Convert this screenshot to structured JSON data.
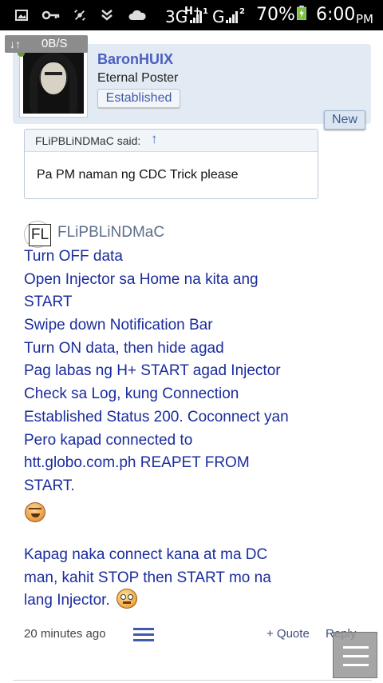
{
  "status_bar": {
    "network_label": "3G",
    "network_sub": "H+",
    "signal_label": "G",
    "battery": "70%",
    "time": "6:00",
    "ampm": "PM",
    "icons": [
      "image-icon",
      "key-icon",
      "no-satellite-icon",
      "download-icon",
      "cloud-icon",
      "signal-icon",
      "battery-icon"
    ]
  },
  "speed_overlay": {
    "arrows": "↓↑",
    "rate": "0B/S"
  },
  "post": {
    "username": "BaronHUIX",
    "user_title": "Eternal Poster",
    "badge": "Established",
    "new_badge": "New"
  },
  "quote": {
    "author": "FLiPBLiNDMaC said:",
    "arrow": "↑",
    "text": "Pa PM naman ng CDC Trick please"
  },
  "reply": {
    "author_initials": "FL",
    "author": "FLiPBLiNDMaC",
    "lines": [
      "Turn OFF data",
      "Open Injector sa Home na kita ang",
      "START",
      "Swipe down Notification Bar",
      "Turn ON data, then hide agad",
      "Pag labas ng H+ START agad Injector",
      "Check sa Log, kung Connection",
      "Established Status 200. Coconnect yan",
      "Pero kapad connected to",
      "htt.globo.com.ph REAPET FROM",
      "START."
    ],
    "lines2": [
      "Kapag naka connect kana at ma DC",
      "man, kahit STOP then START mo na"
    ],
    "last_line": "lang Injector."
  },
  "footer": {
    "time": "20 minutes ago",
    "quote_label": "+ Quote",
    "reply_label": "Reply"
  }
}
